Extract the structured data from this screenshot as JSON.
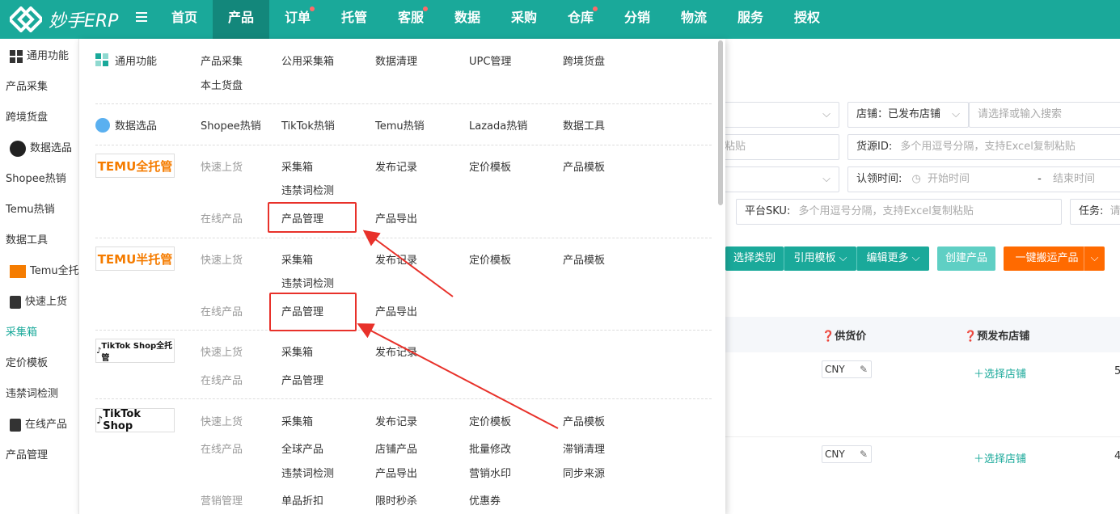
{
  "brand": {
    "name": "妙手ERP",
    "accent": "#1aa99a",
    "accent_dark": "#13877b",
    "danger": "#e8312a"
  },
  "nav": {
    "items": [
      {
        "label": "首页",
        "dot": false
      },
      {
        "label": "产品",
        "dot": false,
        "active": true
      },
      {
        "label": "订单",
        "dot": true
      },
      {
        "label": "托管",
        "dot": false
      },
      {
        "label": "客服",
        "dot": true
      },
      {
        "label": "数据",
        "dot": false
      },
      {
        "label": "采购",
        "dot": false
      },
      {
        "label": "仓库",
        "dot": true
      },
      {
        "label": "分销",
        "dot": false
      },
      {
        "label": "物流",
        "dot": false
      },
      {
        "label": "服务",
        "dot": false
      },
      {
        "label": "授权",
        "dot": false
      }
    ]
  },
  "sidebar": {
    "items": [
      {
        "label": "通用功能",
        "icon": "grid-icon"
      },
      {
        "label": "产品采集"
      },
      {
        "label": "跨境货盘"
      },
      {
        "label": "数据选品",
        "icon": "flame-icon"
      },
      {
        "label": "Shopee热销"
      },
      {
        "label": "Temu热销"
      },
      {
        "label": "数据工具"
      },
      {
        "label": "Temu全托",
        "icon": "temu-icon"
      },
      {
        "label": "快速上货",
        "icon": "bag-icon"
      },
      {
        "label": "采集箱",
        "active": true
      },
      {
        "label": "定价模板"
      },
      {
        "label": "违禁词检测"
      },
      {
        "label": "在线产品",
        "icon": "bag-icon"
      },
      {
        "label": "产品管理"
      }
    ]
  },
  "dropdown": {
    "general": {
      "title": "通用功能",
      "links": [
        "产品采集",
        "公用采集箱",
        "数据清理",
        "UPC管理",
        "跨境货盘",
        "本土货盘"
      ]
    },
    "data": {
      "title": "数据选品",
      "links": [
        "Shopee热销",
        "TikTok热销",
        "Temu热销",
        "Lazada热销",
        "数据工具"
      ]
    },
    "temu_full": {
      "brand": "TEMU全托管",
      "quick": {
        "label": "快速上货",
        "links": [
          "采集箱",
          "发布记录",
          "定价模板",
          "产品模板",
          "违禁词检测"
        ]
      },
      "online": {
        "label": "在线产品",
        "links": [
          "产品管理",
          "产品导出"
        ]
      }
    },
    "temu_half": {
      "brand": "TEMU半托管",
      "quick": {
        "label": "快速上货",
        "links": [
          "采集箱",
          "发布记录",
          "定价模板",
          "产品模板",
          "违禁词检测"
        ]
      },
      "online": {
        "label": "在线产品",
        "links": [
          "产品管理",
          "产品导出"
        ]
      }
    },
    "tiktok_full": {
      "brand": "TikTok Shop全托管",
      "quick": {
        "label": "快速上货",
        "links": [
          "采集箱",
          "发布记录"
        ]
      },
      "online": {
        "label": "在线产品",
        "links": [
          "产品管理"
        ]
      }
    },
    "tiktok": {
      "brand": "TikTok Shop",
      "quick": {
        "label": "快速上货",
        "links": [
          "采集箱",
          "发布记录",
          "定价模板",
          "产品模板"
        ]
      },
      "online": {
        "label": "在线产品",
        "links": [
          "全球产品",
          "店铺产品",
          "批量修改",
          "滞销清理",
          "违禁词检测",
          "产品导出",
          "营销水印",
          "同步来源"
        ]
      },
      "marketing": {
        "label": "营销管理",
        "links": [
          "单品折扣",
          "限时秒杀",
          "优惠券"
        ]
      }
    }
  },
  "filters": {
    "store_label": "店铺：已发布店铺",
    "store_search_placeholder": "请选择或输入搜索",
    "paste_tail": "粘贴",
    "source_id_label": "货源ID:",
    "source_id_placeholder": "多个用逗号分隔，支持Excel复制粘贴",
    "claim_time_label": "认领时间:",
    "start_placeholder": "开始时间",
    "range_sep": "-",
    "end_placeholder": "结束时间",
    "platform_sku_label": "平台SKU:",
    "platform_sku_placeholder": "多个用逗号分隔，支持Excel复制粘贴",
    "task_label": "任务:",
    "task_tail": "请"
  },
  "toolbar": {
    "select_category": "选择类别",
    "apply_template": "引用模板",
    "edit_more": "编辑更多",
    "create_product": "创建产品",
    "one_click_move": "一键搬运产品"
  },
  "table": {
    "col_supply_price": "供货价",
    "col_pre_publish_store": "预发布店铺",
    "rows": [
      {
        "currency": "CNY",
        "pick_store": "选择店铺",
        "tail": "5"
      },
      {
        "currency": "CNY",
        "pick_store": "选择店铺",
        "tail": "4"
      }
    ]
  }
}
